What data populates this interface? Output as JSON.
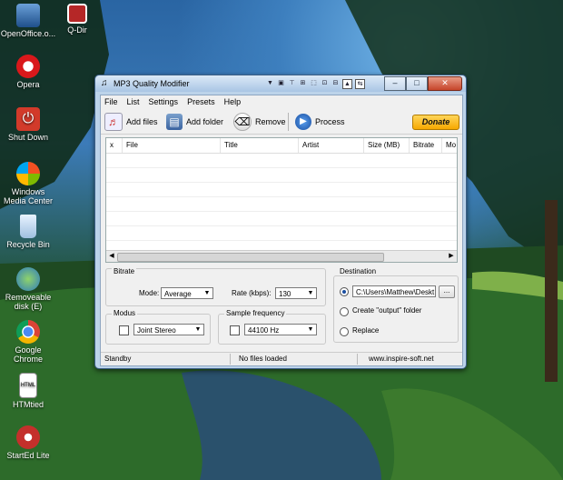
{
  "desktop": {
    "icons": [
      {
        "label": "OpenOffice.o..."
      },
      {
        "label": "Q-Dir"
      },
      {
        "label": "Opera"
      },
      {
        "label": "Shut Down"
      },
      {
        "label": "Windows Media Center"
      },
      {
        "label": "Recycle Bin"
      },
      {
        "label": "Removeable disk (E)"
      },
      {
        "label": "Google Chrome"
      },
      {
        "label": "HTMtied"
      },
      {
        "label": "StartEd Lite"
      }
    ]
  },
  "window": {
    "title": "MP3 Quality Modifier",
    "menu": [
      "File",
      "List",
      "Settings",
      "Presets",
      "Help"
    ],
    "toolbar": {
      "add_files": "Add files",
      "add_folder": "Add folder",
      "remove": "Remove",
      "process": "Process",
      "donate": "Donate"
    },
    "list": {
      "columns": [
        "x",
        "File",
        "Title",
        "Artist",
        "Size  (MB)",
        "Bitrate",
        "Mo"
      ]
    },
    "bitrate": {
      "title": "Bitrate",
      "mode_label": "Mode:",
      "mode_value": "Average",
      "rate_label": "Rate (kbps):",
      "rate_value": "130"
    },
    "modus": {
      "title": "Modus",
      "value": "Joint Stereo"
    },
    "sample": {
      "title": "Sample frequency",
      "value": "44100 Hz"
    },
    "destination": {
      "title": "Destination",
      "path": "C:\\Users\\Matthew\\Deskt",
      "browse": "...",
      "opt_output": "Create \"output\" folder",
      "opt_replace": "Replace"
    },
    "status": {
      "state": "Standby",
      "files": "No files loaded",
      "site": "www.inspire-soft.net"
    }
  }
}
